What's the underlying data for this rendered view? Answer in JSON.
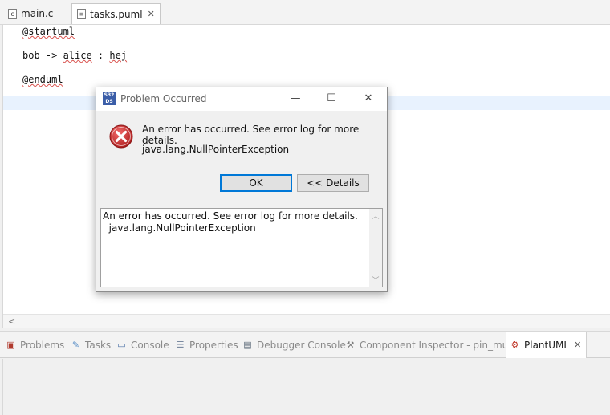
{
  "editor_tabs": [
    {
      "label": "main.c",
      "icon": "c-file-icon",
      "active": false
    },
    {
      "label": "tasks.puml",
      "icon": "puml-file-icon",
      "active": true,
      "close": "✕"
    }
  ],
  "editor": {
    "lines": [
      "@startuml",
      "",
      "bob -> alice : hej",
      "",
      "@enduml"
    ],
    "scroll_left_arrow": "<"
  },
  "dialog": {
    "title": "Problem Occurred",
    "app_icon_text": "S32 DS",
    "message": "An error has occurred. See error log for more details.",
    "exception": "java.lang.NullPointerException",
    "ok_label": "OK",
    "details_label": "<< Details",
    "details_text": "An error has occurred. See error log for more details.\n  java.lang.NullPointerException",
    "minimize": "—",
    "maximize": "☐",
    "close": "✕"
  },
  "view_tabs": [
    {
      "label": "Problems",
      "icon": "problems-icon"
    },
    {
      "label": "Tasks",
      "icon": "tasks-icon"
    },
    {
      "label": "Console",
      "icon": "console-icon"
    },
    {
      "label": "Properties",
      "icon": "properties-icon"
    },
    {
      "label": "Debugger Console",
      "icon": "debugger-console-icon"
    },
    {
      "label": "Component Inspector - pin_mux",
      "icon": "component-inspector-icon"
    },
    {
      "label": "PlantUML",
      "icon": "plantuml-icon",
      "active": true,
      "close": "✕"
    }
  ],
  "colors": {
    "accent": "#0078d7",
    "error": "#c9302c",
    "current_line": "#e8f2fe"
  }
}
